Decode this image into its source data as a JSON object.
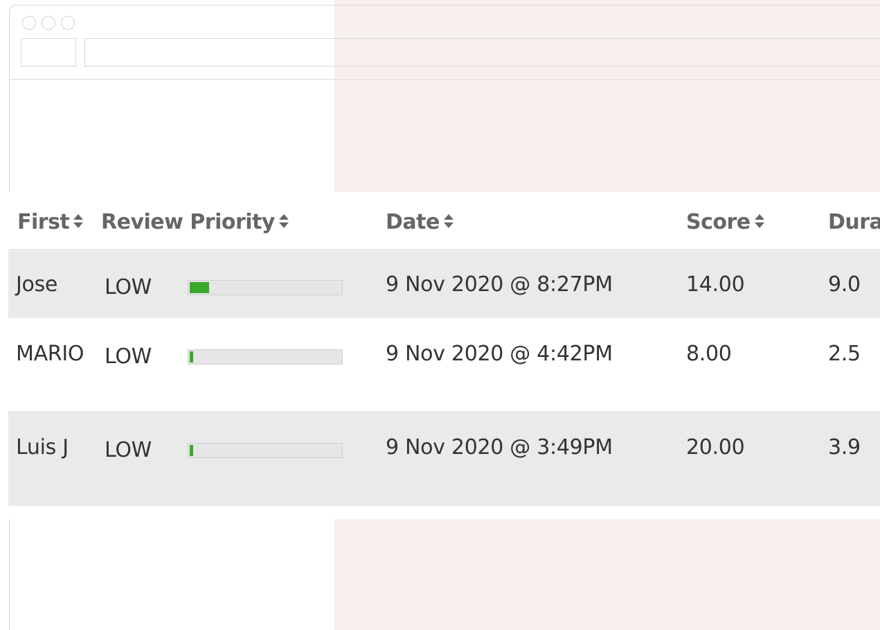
{
  "table": {
    "columns": [
      {
        "label": "First"
      },
      {
        "label": "Review Priority"
      },
      {
        "label": "Date"
      },
      {
        "label": "Score"
      },
      {
        "label": "Dura"
      }
    ],
    "rows": [
      {
        "first": "Jose",
        "priority": "LOW",
        "priority_level": 0.13,
        "date": "9 Nov 2020 @ 8:27PM",
        "score": "14.00",
        "duration": "9.0"
      },
      {
        "first": "MARIO",
        "priority": "LOW",
        "priority_level": 0.02,
        "date": "9 Nov 2020 @ 4:42PM",
        "score": "8.00",
        "duration": "2.5"
      },
      {
        "first": "Luis J",
        "priority": "LOW",
        "priority_level": 0.02,
        "date": "9 Nov 2020 @ 3:49PM",
        "score": "20.00",
        "duration": "3.9"
      }
    ]
  },
  "icons": {
    "sort": "sort-up-down-icon"
  },
  "colors": {
    "progress_fill": "#3aa82a",
    "row_shade": "#eaeaea",
    "panel_tint": "#f7efec"
  }
}
